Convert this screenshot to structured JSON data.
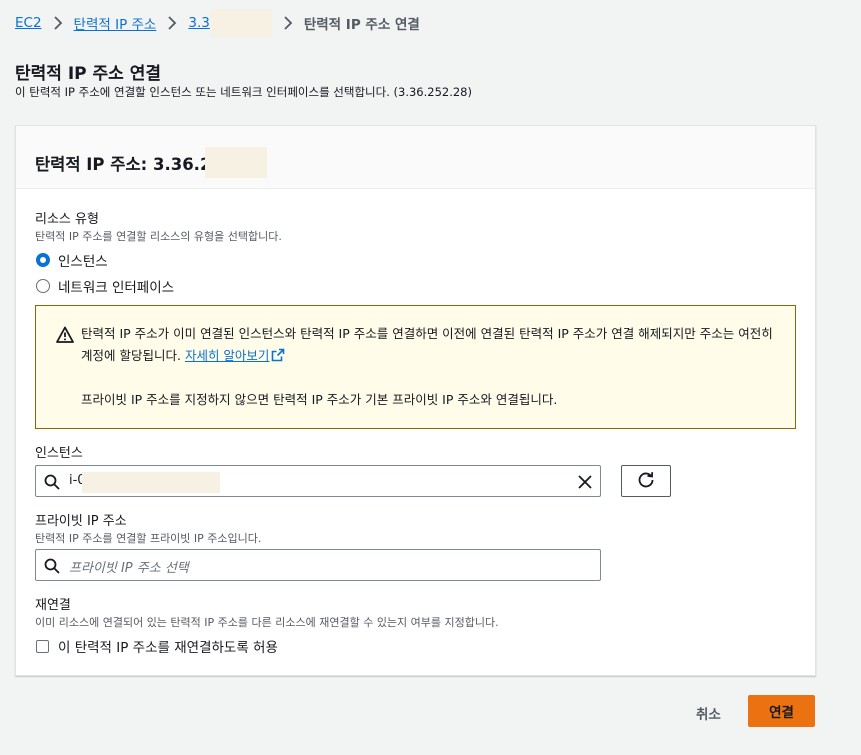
{
  "breadcrumb": {
    "items": [
      "EC2",
      "탄력적 IP 주소",
      "3.3"
    ],
    "current": "탄력적 IP 주소 연결"
  },
  "page": {
    "title": "탄력적 IP 주소 연결",
    "description": "이 탄력적 IP 주소에 연결할 인스턴스 또는 네트워크 인터페이스를 선택합니다. (3.36.252.28)"
  },
  "panel": {
    "title": "탄력적 IP 주소: 3.36.2"
  },
  "resource_type": {
    "label": "리소스 유형",
    "description": "탄력적 IP 주소를 연결할 리소스의 유형을 선택합니다.",
    "options": [
      "인스턴스",
      "네트워크 인터페이스"
    ],
    "selected": "인스턴스"
  },
  "alert": {
    "text": "탄력적 IP 주소가 이미 연결된 인스턴스와 탄력적 IP 주소를 연결하면 이전에 연결된 탄력적 IP 주소가 연결 해제되지만 주소는 여전히 계정에 할당됩니다.",
    "link": "자세히 알아보기",
    "text2": "프라이빗 IP 주소를 지정하지 않으면 탄력적 IP 주소가 기본 프라이빗 IP 주소와 연결됩니다."
  },
  "instance": {
    "label": "인스턴스",
    "value": "i-0"
  },
  "private_ip": {
    "label": "프라이빗 IP 주소",
    "description": "탄력적 IP 주소를 연결할 프라이빗 IP 주소입니다.",
    "placeholder": "프라이빗 IP 주소 선택"
  },
  "reassociation": {
    "label": "재연결",
    "description": "이미 리소스에 연결되어 있는 탄력적 IP 주소를 다른 리소스에 재연결할 수 있는지 여부를 지정합니다.",
    "checkbox_label": "이 탄력적 IP 주소를 재연결하도록 허용",
    "checked": false
  },
  "actions": {
    "cancel": "취소",
    "connect": "연결"
  },
  "colors": {
    "link": "#0972d3",
    "primary_button": "#ec7211",
    "alert_bg": "#fffce9",
    "alert_border": "#8d6605"
  },
  "icons": [
    "chevron-right-icon",
    "warning-icon",
    "external-link-icon",
    "search-icon",
    "close-icon",
    "refresh-icon"
  ]
}
